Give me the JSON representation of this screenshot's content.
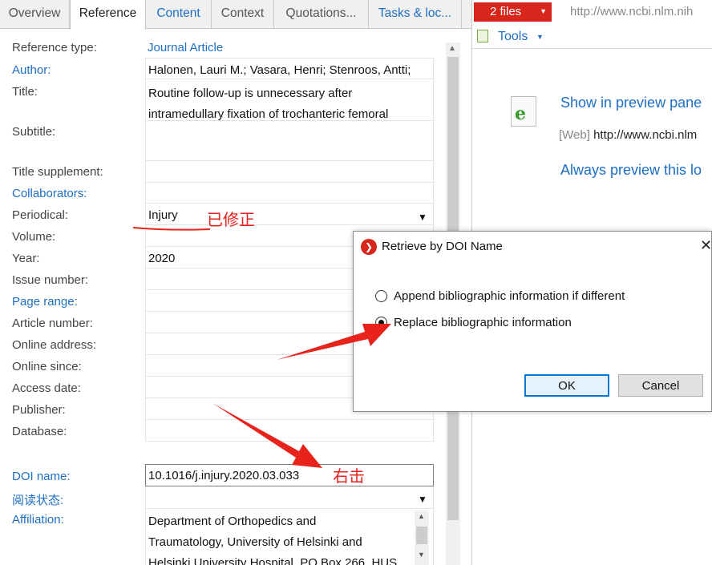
{
  "tabs": [
    {
      "label": "Overview",
      "state": "gray"
    },
    {
      "label": "Reference",
      "state": "active"
    },
    {
      "label": "Content",
      "state": "blue"
    },
    {
      "label": "Context",
      "state": "gray"
    },
    {
      "label": "Quotations...",
      "state": "gray"
    },
    {
      "label": "Tasks & loc...",
      "state": "blue"
    }
  ],
  "form": {
    "reference_type_label": "Reference type:",
    "reference_type_value": "Journal Article",
    "author_label": "Author:",
    "author_value": "Halonen, Lauri M.; Vasara, Henri; Stenroos, Antti;",
    "title_label": "Title:",
    "title_line1": "Routine follow-up is unnecessary after",
    "title_line2": "intramedullary fixation of trochanteric femoral",
    "subtitle_label": "Subtitle:",
    "title_supplement_label": "Title supplement:",
    "collaborators_label": "Collaborators:",
    "periodical_label": "Periodical:",
    "periodical_value": "Injury",
    "volume_label": "Volume:",
    "year_label": "Year:",
    "year_value": "2020",
    "issue_label": "Issue number:",
    "page_range_label": "Page range:",
    "article_number_label": "Article number:",
    "online_address_label": "Online address:",
    "online_since_label": "Online since:",
    "access_date_label": "Access date:",
    "publisher_label": "Publisher:",
    "database_label": "Database:",
    "doi_label": "DOI name:",
    "doi_value": "10.1016/j.injury.2020.03.033",
    "reading_status_label": "阅读状态:",
    "affiliation_label": "Affiliation:",
    "affiliation_line1": "Department of Orthopedics and",
    "affiliation_line2": "Traumatology, University of Helsinki and",
    "affiliation_line3": "Helsinki University Hospital, PO Box 266, HUS"
  },
  "right_pane": {
    "files_button": "2 files",
    "url": "http://www.ncbi.nlm.nih",
    "tools_label": "Tools",
    "show_preview": "Show in preview pane",
    "web_tag": "[Web]",
    "web_url": "http://www.ncbi.nlm",
    "always_preview": "Always preview this lo"
  },
  "dialog": {
    "title": "Retrieve by DOI Name",
    "option_append": "Append bibliographic information if different",
    "option_replace": "Replace bibliographic information",
    "selected_option": "replace",
    "ok_label": "OK",
    "cancel_label": "Cancel"
  },
  "annotations": {
    "corrected": "已修正",
    "right_click": "右击",
    "color": "#e8231c"
  }
}
